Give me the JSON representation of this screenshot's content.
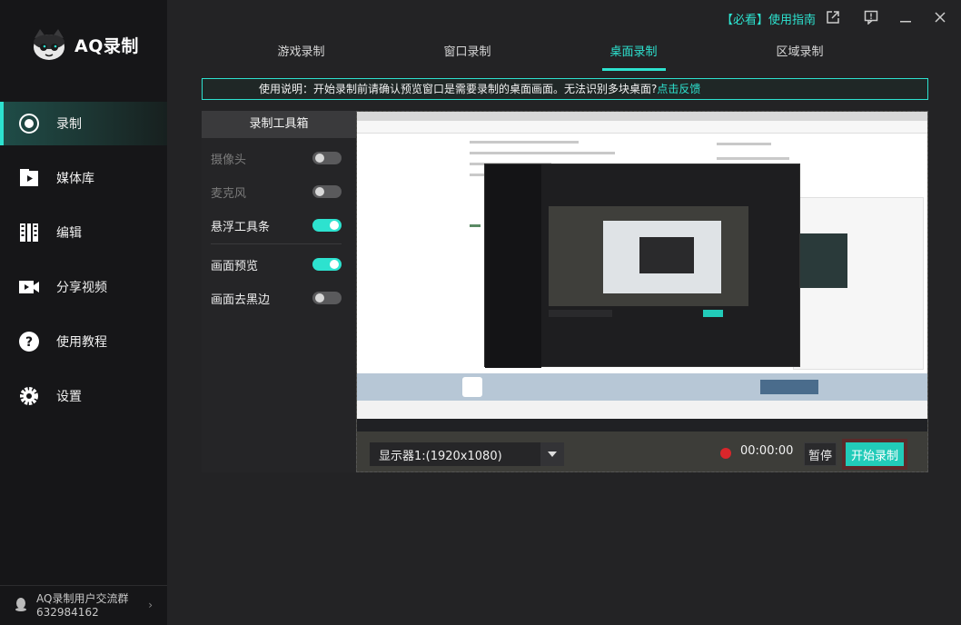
{
  "app": {
    "name": "AQ录制",
    "brand_color": "#2de2cf"
  },
  "sidebar": {
    "items": [
      {
        "label": "录制",
        "icon": "record-icon",
        "active": true
      },
      {
        "label": "媒体库",
        "icon": "media-library-icon"
      },
      {
        "label": "编辑",
        "icon": "film-edit-icon"
      },
      {
        "label": "分享视频",
        "icon": "video-share-icon"
      },
      {
        "label": "使用教程",
        "icon": "help-icon"
      },
      {
        "label": "设置",
        "icon": "gear-icon"
      }
    ],
    "community": {
      "title": "AQ录制用户交流群",
      "number": "632984162"
    }
  },
  "topbar": {
    "guide_label": "【必看】使用指南",
    "icons": [
      "external-link-icon",
      "feedback-icon",
      "minimize-icon",
      "close-icon"
    ]
  },
  "tabs": [
    {
      "label": "游戏录制"
    },
    {
      "label": "窗口录制"
    },
    {
      "label": "桌面录制",
      "active": true
    },
    {
      "label": "区域录制"
    }
  ],
  "banner": {
    "text": "使用说明：开始录制前请确认预览窗口是需要录制的桌面画面。无法识别多块桌面?",
    "link": "点击反馈"
  },
  "toolbox": {
    "title": "录制工具箱",
    "options": [
      {
        "label": "摄像头",
        "enabled": false
      },
      {
        "label": "麦克风",
        "enabled": false
      },
      {
        "label": "悬浮工具条",
        "enabled": true
      },
      {
        "label": "画面预览",
        "enabled": true
      },
      {
        "label": "画面去黑边",
        "enabled": false
      }
    ]
  },
  "controls": {
    "display": "显示器1:(1920x1080)",
    "timer": "00:00:00",
    "pause_label": "暂停",
    "start_label": "开始录制"
  }
}
